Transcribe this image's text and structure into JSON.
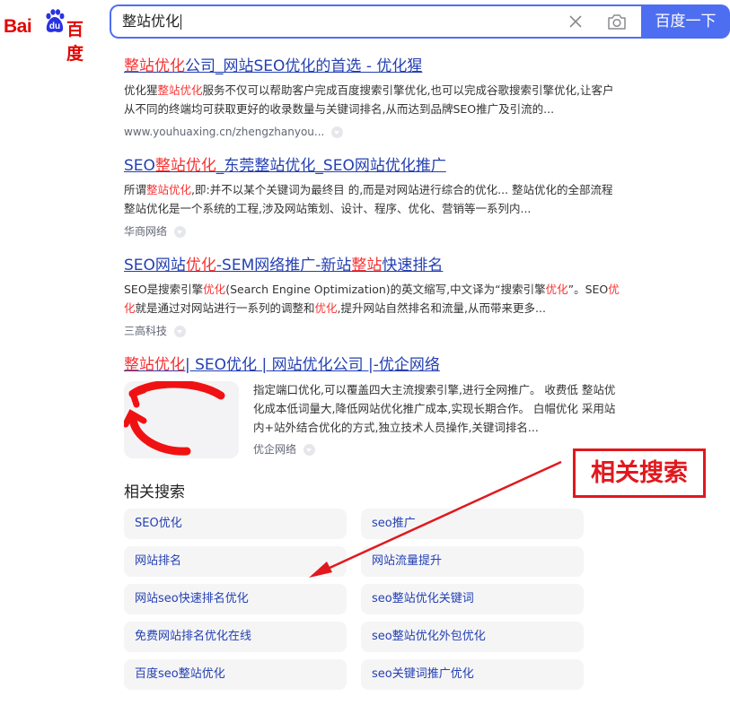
{
  "logo": {
    "bai": "Bai",
    "du": "du",
    "cn": "百度"
  },
  "search": {
    "query": "整站优化",
    "button_label": "百度一下"
  },
  "results": [
    {
      "title_segments": [
        {
          "t": "整站优化",
          "hl": true
        },
        {
          "t": "公司_网站SEO优化的首选 - 优化猩",
          "hl": false
        }
      ],
      "abstract_segments": [
        {
          "t": "优化猩",
          "hl": false
        },
        {
          "t": "整站优化",
          "hl": true
        },
        {
          "t": "服务不仅可以帮助客户完成百度搜索引擎优化,也可以完成谷歌搜索引擎优化,让客户从不同的终端均可获取更好的收录数量与关键词排名,从而达到品牌SEO推广及引流的...",
          "hl": false
        }
      ],
      "source": "www.youhuaxing.cn/zhengzhanyou..."
    },
    {
      "title_segments": [
        {
          "t": "SEO",
          "hl": false
        },
        {
          "t": "整站优化",
          "hl": true
        },
        {
          "t": "_东莞整站优化_SEO网站优化推广",
          "hl": false
        }
      ],
      "abstract_segments": [
        {
          "t": "所谓",
          "hl": false
        },
        {
          "t": "整站优化",
          "hl": true
        },
        {
          "t": ",即:并不以某个关键词为最终目 的,而是对网站进行综合的优化... 整站优化的全部流程 整站优化是一个系统的工程,涉及网站策划、设计、程序、优化、营销等一系列内...",
          "hl": false
        }
      ],
      "source": "华商网络"
    },
    {
      "title_segments": [
        {
          "t": "SEO网站",
          "hl": false
        },
        {
          "t": "优化",
          "hl": true
        },
        {
          "t": "-SEM网络推广-新站",
          "hl": false
        },
        {
          "t": "整站",
          "hl": true
        },
        {
          "t": "快速排名",
          "hl": false
        }
      ],
      "abstract_segments": [
        {
          "t": "SEO是搜索引擎",
          "hl": false
        },
        {
          "t": "优化",
          "hl": true
        },
        {
          "t": "(Search Engine Optimization)的英文缩写,中文译为“搜索引擎",
          "hl": false
        },
        {
          "t": "优化",
          "hl": true
        },
        {
          "t": "”。SEO",
          "hl": false
        },
        {
          "t": "优化",
          "hl": true
        },
        {
          "t": "就是通过对网站进行一系列的调整和",
          "hl": false
        },
        {
          "t": "优化",
          "hl": true
        },
        {
          "t": ",提升网站自然排名和流量,从而带来更多...",
          "hl": false
        }
      ],
      "source": "三高科技"
    },
    {
      "title_segments": [
        {
          "t": "整站优化",
          "hl": true
        },
        {
          "t": "| SEO优化 | 网站优化公司 |-优企网络",
          "hl": false
        }
      ],
      "abstract_segments": [
        {
          "t": "指定端口优化,可以覆盖四大主流搜索引擎,进行全网推广。 收费低 ",
          "hl": false
        },
        {
          "t": "整站优化",
          "hl": true
        },
        {
          "t": "成本低词量大,降低网站优化推广成本,实现长期合作。 白帽优化 采用站内+站外结合优化的方式,独立技术人员操作,关键词排名...",
          "hl": false
        }
      ],
      "source": "优企网络"
    }
  ],
  "related": {
    "title": "相关搜索",
    "items": [
      "SEO优化",
      "seo推广",
      "网站排名",
      "网站流量提升",
      "网站seo快速排名优化",
      "seo整站优化关键词",
      "免费网站排名优化在线",
      "seo整站优化外包优化",
      "百度seo整站优化",
      "seo关键词推广优化"
    ]
  },
  "annotation": {
    "label": "相关搜索",
    "color": "#e0191e"
  },
  "colors": {
    "accent": "#4e6ef2",
    "link": "#2440b3",
    "highlight": "#f73131",
    "logo_red": "#e10601"
  }
}
